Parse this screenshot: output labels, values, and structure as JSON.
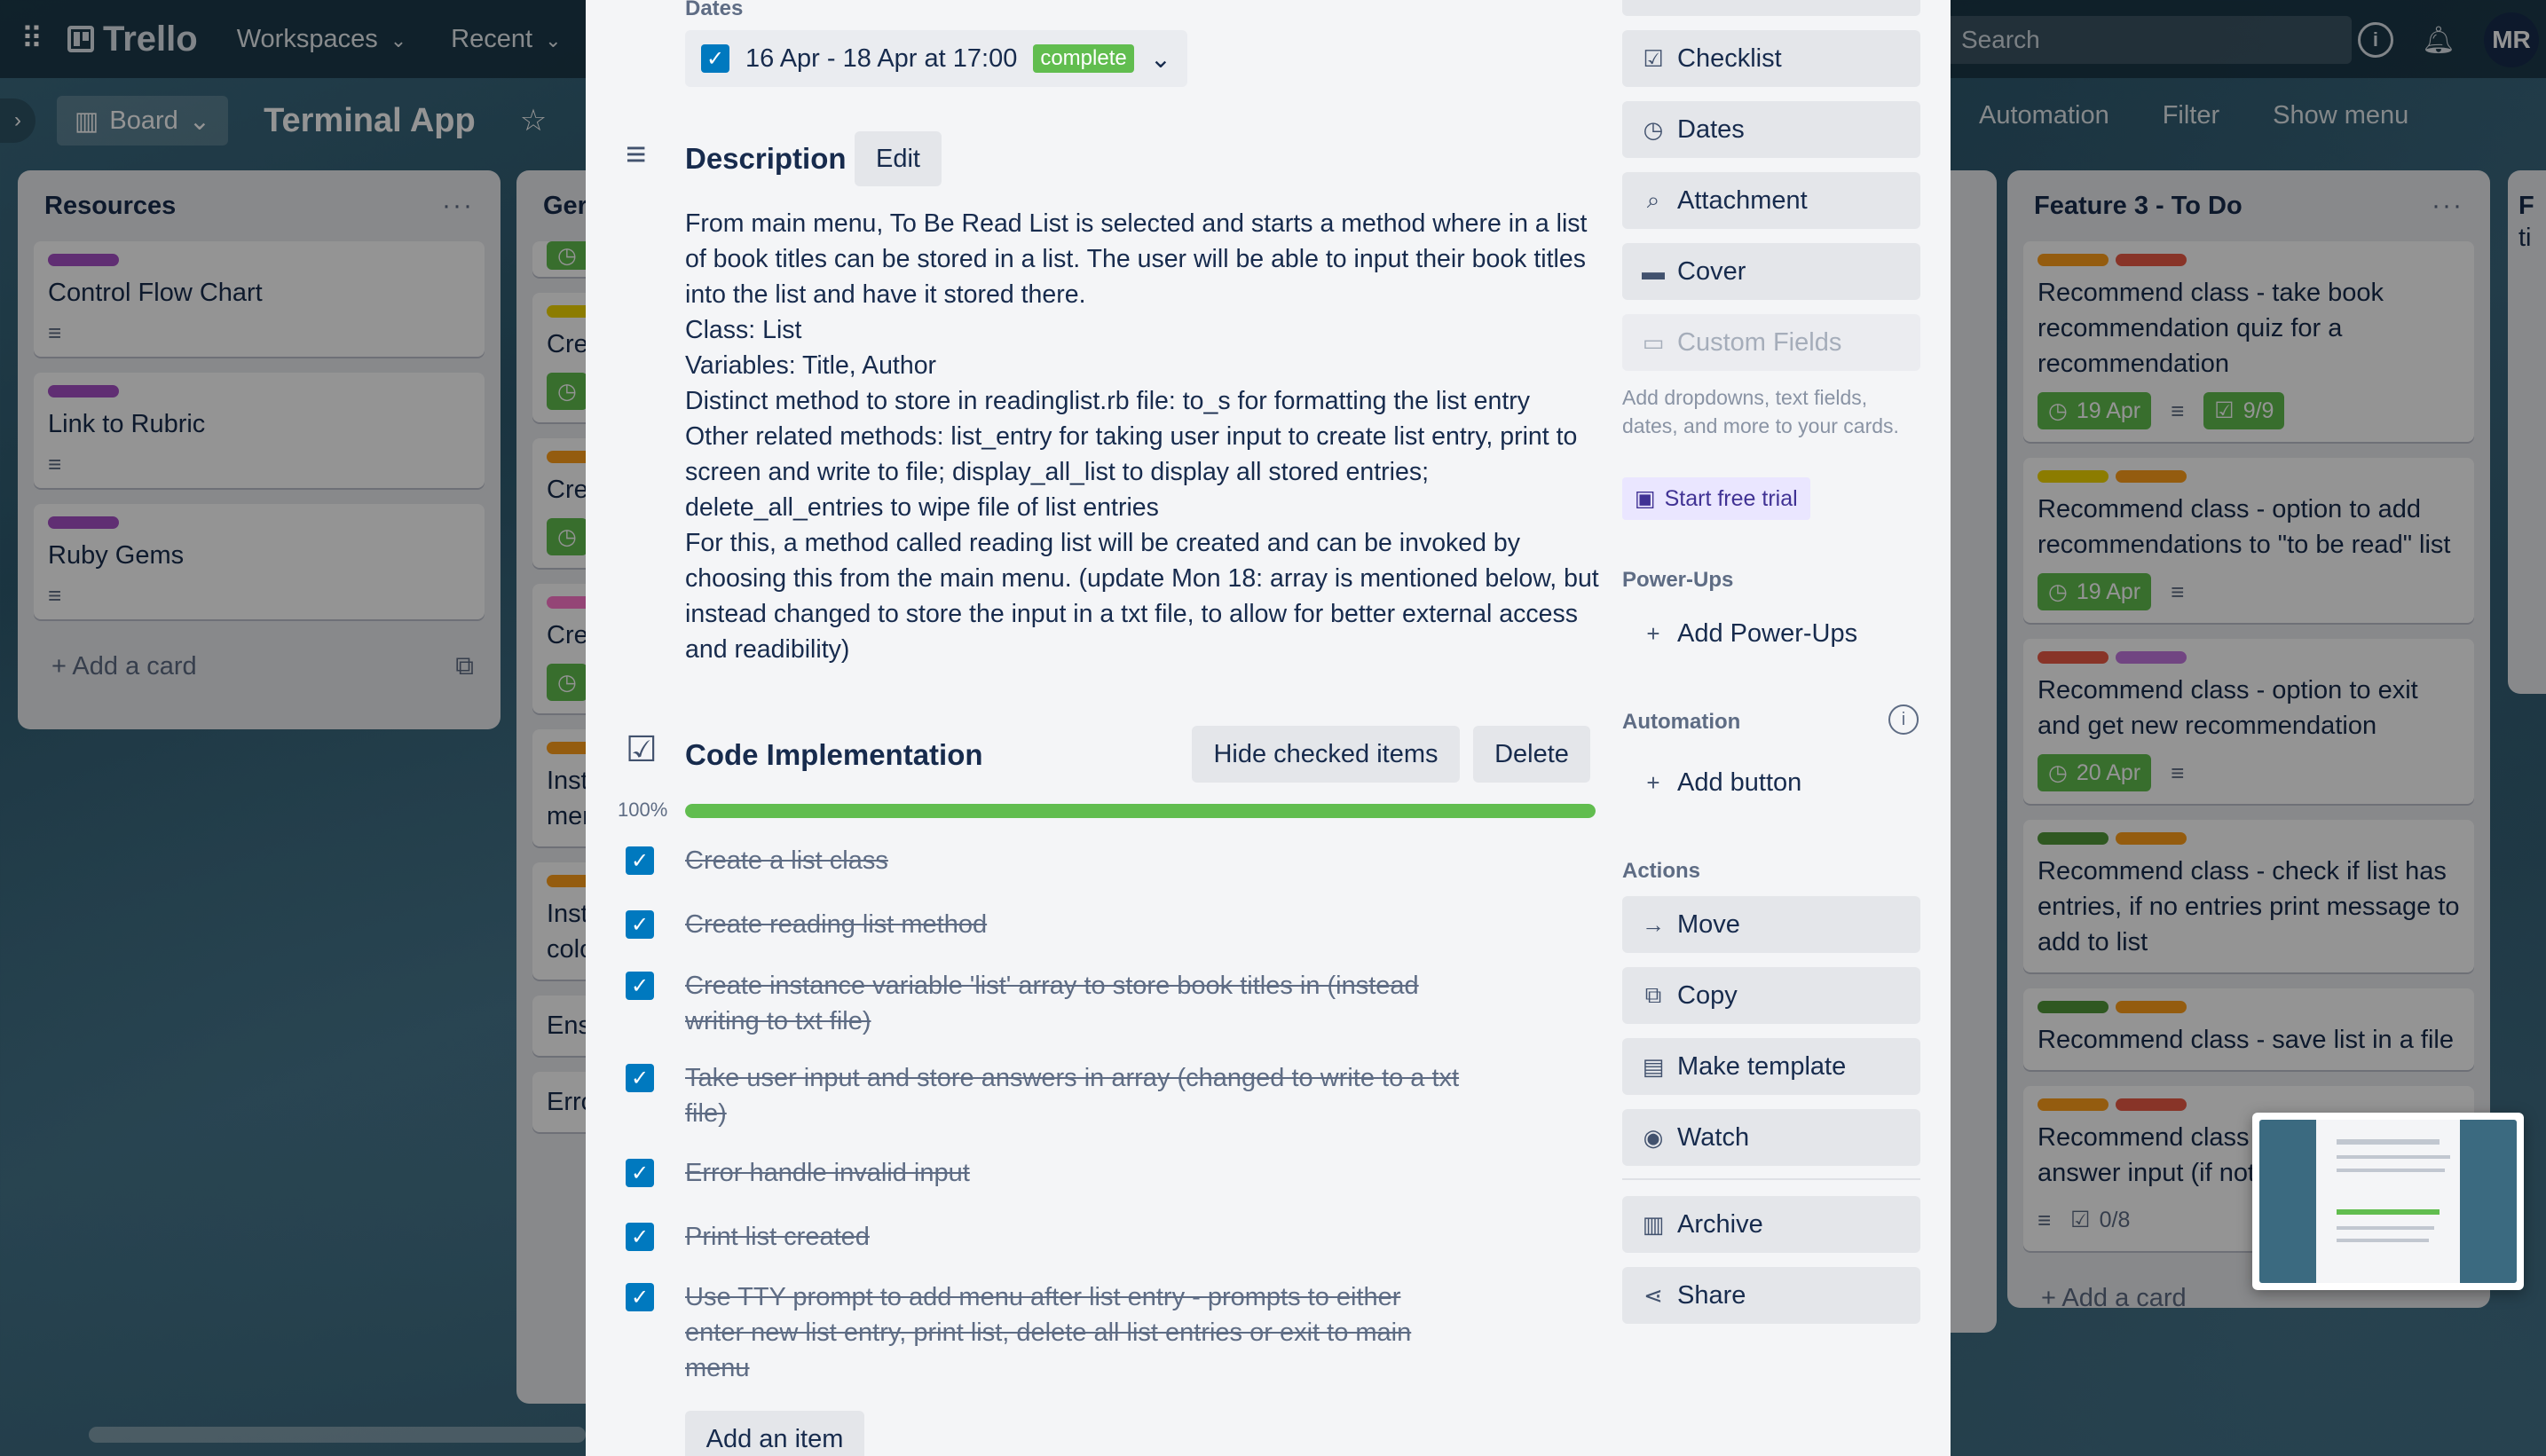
{
  "topbar": {
    "logo": "Trello",
    "nav": [
      {
        "label": "Workspaces"
      },
      {
        "label": "Recent"
      }
    ],
    "search_placeholder": "Search",
    "avatar_initials": "MR"
  },
  "board": {
    "view": "Board",
    "title": "Terminal App",
    "right_actions": [
      "Automation",
      "Filter",
      "Show menu"
    ]
  },
  "lists": {
    "resources": {
      "title": "Resources",
      "cards": [
        "Control Flow Chart",
        "Link to Rubric",
        "Ruby Gems"
      ],
      "add_card": "Add a card"
    },
    "general": {
      "title_partial": "Ger",
      "cards_partial": [
        "Cre",
        "Cre",
        "Cre",
        "Inst",
        "mer",
        "Inst",
        "colo",
        "Ens",
        "Erro"
      ]
    },
    "feature3": {
      "title": "Feature 3 - To Do",
      "cards": [
        {
          "text": "Recommend class - take book recommendation quiz for a recommendation",
          "due": "19 Apr",
          "checklist": "9/9"
        },
        {
          "text": "Recommend class - option to add recommendations to \"to be read\" list",
          "due": "19 Apr"
        },
        {
          "text": "Recommend class - option to exit and get new recommendation",
          "due": "20 Apr"
        },
        {
          "text": "Recommend class - check if list has entries, if no entries print message to add to list"
        },
        {
          "text": "Recommend class - save list in a file"
        },
        {
          "text": "Recommend class - confirm valid answer input (if not",
          "checklist": "0/8"
        }
      ],
      "add_card": "Add a card"
    },
    "next_partial": {
      "title_partial": "F",
      "sub_partial": "ti"
    }
  },
  "modal": {
    "dates_label": "Dates",
    "dates_value": "16 Apr - 18 Apr at 17:00",
    "dates_status": "complete",
    "description_title": "Description",
    "edit_label": "Edit",
    "description_lines": [
      "From main menu, To Be Read List is selected and starts a method where in a list of book titles can be stored in a list. The user will be able to input their book titles into the list and have it stored there.",
      "Class: List",
      "Variables: Title, Author",
      "Distinct method to store in readinglist.rb file: to_s for formatting the list entry",
      "Other related methods: list_entry for taking user input to create list entry, print to screen and write to file; display_all_list to display all stored entries; delete_all_entries to wipe file of list entries",
      "For this, a method called reading list will be created and can be invoked by choosing this from the main menu. (update Mon 18: array is mentioned below, but instead changed to store the input in a txt file, to allow for better external access and readibility)"
    ],
    "checklist": {
      "title": "Code Implementation",
      "hide_label": "Hide checked items",
      "delete_label": "Delete",
      "percent": "100%",
      "progress": 1.0,
      "items": [
        "Create a list class",
        "Create reading list method",
        "Create instance variable 'list' array to store book titles in (instead writing to txt file)",
        "Take user input and store answers in array (changed to write to a txt file)",
        "Error handle invalid input",
        "Print list created",
        "Use TTY prompt to add menu after list entry - prompts to either enter new list entry, print list, delete all list entries or exit to main menu"
      ],
      "add_item": "Add an item"
    },
    "sidebar": {
      "add_to_card": [
        "Checklist",
        "Dates",
        "Attachment",
        "Cover",
        "Custom Fields"
      ],
      "upsell": "Add dropdowns, text fields, dates, and more to your cards.",
      "trial": "Start free trial",
      "powerups_head": "Power-Ups",
      "add_powerups": "Add Power-Ups",
      "automation_head": "Automation",
      "add_button": "Add button",
      "actions_head": "Actions",
      "actions": [
        "Move",
        "Copy",
        "Make template",
        "Watch",
        "Archive",
        "Share"
      ]
    }
  },
  "colors": {
    "green": "#61bd4f",
    "blue": "#0079bf",
    "purple": "#a550c6",
    "orange": "#ff9f1a",
    "red": "#eb5a46",
    "yellow": "#f2d600",
    "pink": "#ff78cb",
    "lime": "#51e898"
  }
}
